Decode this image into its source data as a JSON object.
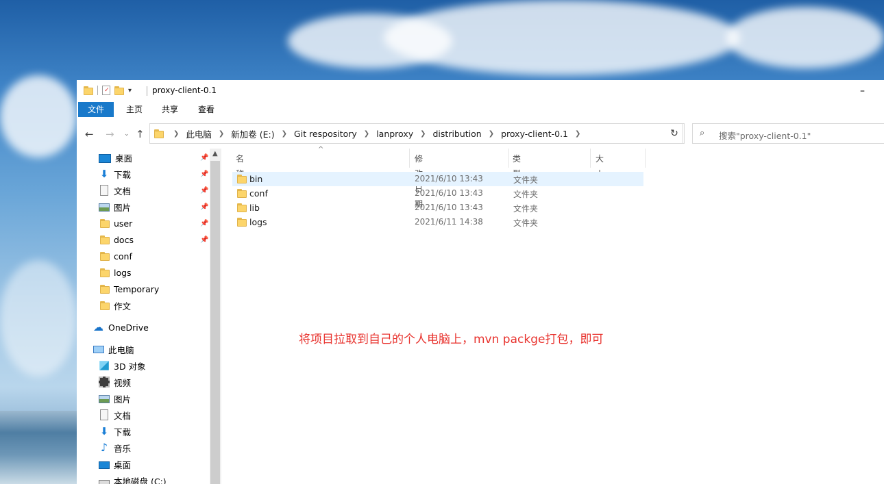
{
  "window": {
    "title": "proxy-client-0.1",
    "minimize_glyph": "–",
    "qat_dropdown_glyph": "▾"
  },
  "ribbon": {
    "tabs": [
      "文件",
      "主页",
      "共享",
      "查看"
    ]
  },
  "address": {
    "breadcrumbs": [
      "此电脑",
      "新加卷 (E:)",
      "Git respository",
      "lanproxy",
      "distribution",
      "proxy-client-0.1"
    ],
    "search_placeholder": "搜索\"proxy-client-0.1\""
  },
  "nav": {
    "quick_access": [
      {
        "label": "桌面",
        "icon": "desktop-icon",
        "pinned": true
      },
      {
        "label": "下载",
        "icon": "download-icon",
        "pinned": true
      },
      {
        "label": "文档",
        "icon": "document-icon",
        "pinned": true
      },
      {
        "label": "图片",
        "icon": "picture-icon",
        "pinned": true
      },
      {
        "label": "user",
        "icon": "folder-icon",
        "pinned": true
      },
      {
        "label": "docs",
        "icon": "folder-icon",
        "pinned": true
      },
      {
        "label": "conf",
        "icon": "folder-icon",
        "pinned": false
      },
      {
        "label": "logs",
        "icon": "folder-icon",
        "pinned": false
      },
      {
        "label": "Temporary",
        "icon": "folder-icon",
        "pinned": false
      },
      {
        "label": "作文",
        "icon": "folder-icon",
        "pinned": false
      }
    ],
    "onedrive": "OneDrive",
    "this_pc": "此电脑",
    "pc_items": [
      {
        "label": "3D 对象",
        "icon": "3d-objects-icon"
      },
      {
        "label": "视频",
        "icon": "video-icon"
      },
      {
        "label": "图片",
        "icon": "picture-icon"
      },
      {
        "label": "文档",
        "icon": "document-icon"
      },
      {
        "label": "下载",
        "icon": "download-icon"
      },
      {
        "label": "音乐",
        "icon": "music-icon"
      },
      {
        "label": "桌面",
        "icon": "desktop-icon"
      },
      {
        "label": "本地磁盘 (C:)",
        "icon": "drive-icon"
      }
    ]
  },
  "files": {
    "columns": [
      "名称",
      "修改日期",
      "类型",
      "大小"
    ],
    "rows": [
      {
        "name": "bin",
        "modified": "2021/6/10 13:43",
        "type": "文件夹",
        "selected": true
      },
      {
        "name": "conf",
        "modified": "2021/6/10 13:43",
        "type": "文件夹",
        "selected": false
      },
      {
        "name": "lib",
        "modified": "2021/6/10 13:43",
        "type": "文件夹",
        "selected": false
      },
      {
        "name": "logs",
        "modified": "2021/6/11 14:38",
        "type": "文件夹",
        "selected": false
      }
    ]
  },
  "annotation": {
    "text": "将项目拉取到自己的个人电脑上，mvn packge打包，即可",
    "color": "#e8322d"
  },
  "colors": {
    "accent": "#1979ca",
    "selection": "#e5f3ff"
  }
}
